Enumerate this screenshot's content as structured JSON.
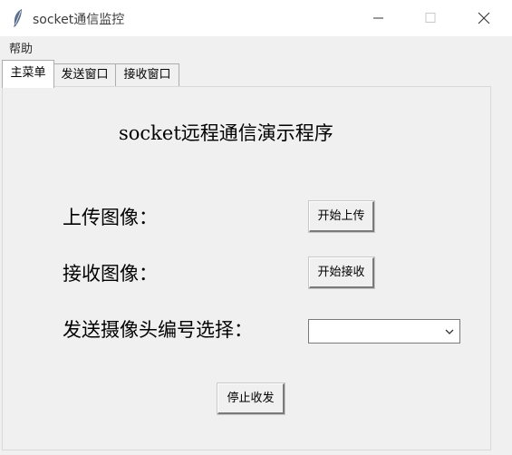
{
  "window": {
    "title": "socket通信监控",
    "icon": "feather-icon"
  },
  "menubar": {
    "items": [
      {
        "label": "帮助"
      }
    ]
  },
  "tabs": [
    {
      "label": "主菜单",
      "active": true
    },
    {
      "label": "发送窗口",
      "active": false
    },
    {
      "label": "接收窗口",
      "active": false
    }
  ],
  "main": {
    "title": "socket远程通信演示程序",
    "upload": {
      "label": "上传图像：",
      "button": "开始上传"
    },
    "receive": {
      "label": "接收图像：",
      "button": "开始接收"
    },
    "camera": {
      "label": "发送摄像头编号选择：",
      "selected_value": ""
    },
    "stop_button": "停止收发"
  }
}
